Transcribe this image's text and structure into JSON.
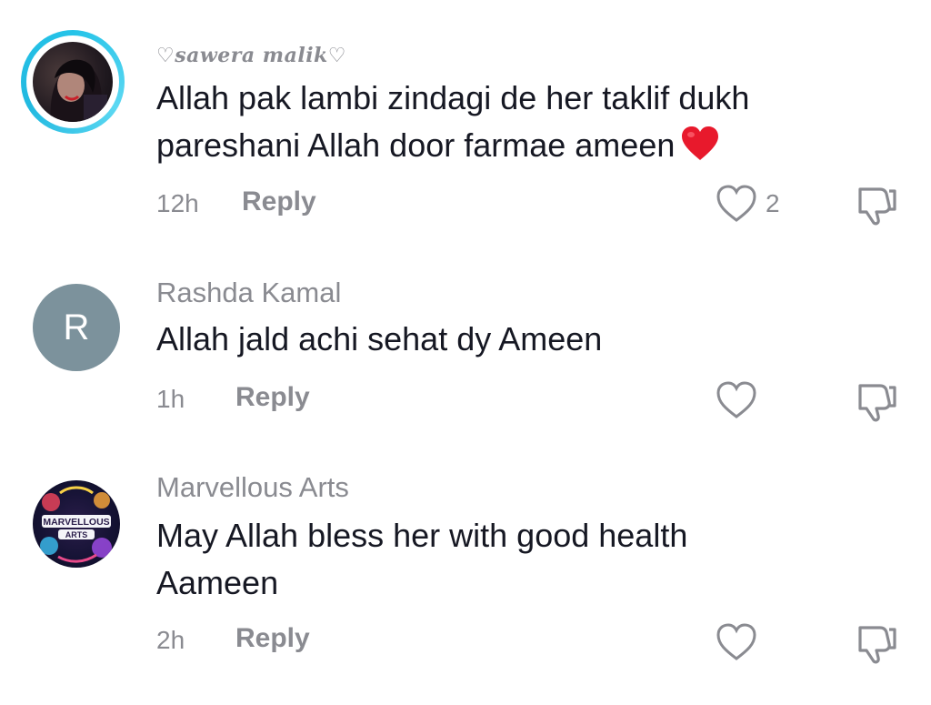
{
  "comments": [
    {
      "username": "♡sawera malik♡",
      "text": "Allah pak lambi zindagi de her taklif dukh pareshani Allah door farmae ameen",
      "emoji": "red-heart",
      "time": "12h",
      "reply_label": "Reply",
      "likes": "2",
      "avatar_icon": "user-photo-avatar",
      "story_ring_color": "#25c3e8"
    },
    {
      "username": "Rashda Kamal",
      "text": "Allah jald achi sehat dy Ameen",
      "time": "1h",
      "reply_label": "Reply",
      "likes": "",
      "avatar_letter": "R",
      "avatar_color": "#7c929c"
    },
    {
      "username": "Marvellous Arts",
      "text": "May Allah bless her with good health Aameen",
      "time": "2h",
      "reply_label": "Reply",
      "likes": "",
      "avatar_logo_line1": "MARVELLOUS",
      "avatar_logo_line2": "ARTS"
    }
  ],
  "colors": {
    "text_primary": "#161823",
    "text_secondary": "#8a8b91",
    "heart_red": "#e8192c"
  }
}
